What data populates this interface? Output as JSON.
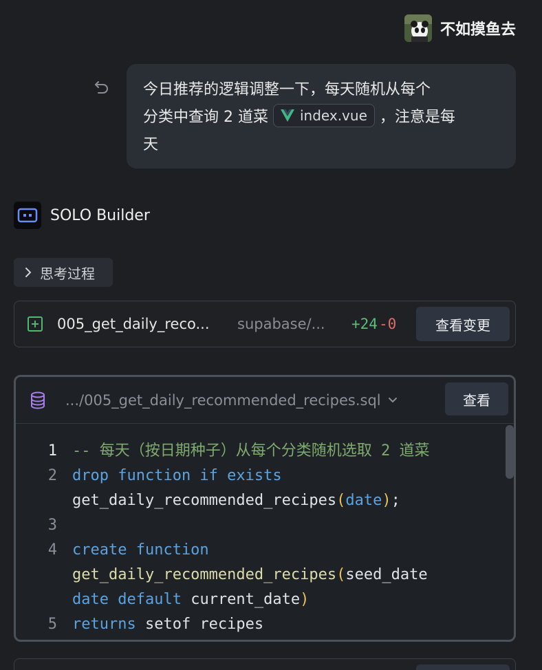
{
  "user": {
    "name": "不如摸鱼去",
    "avatar": "panda-avatar"
  },
  "message": {
    "text_before": "今日推荐的逻辑调整一下，每天随机从每个分类中查询 2 道菜",
    "file_chip": "index.vue",
    "text_after": "，注意是每天",
    "undo_icon": "undo-icon"
  },
  "builder": {
    "name": "SOLO Builder"
  },
  "thinking": {
    "label": "思考过程"
  },
  "change": {
    "file_name": "005_get_daily_reco...",
    "file_path": "supabase/...",
    "additions": "+24",
    "deletions": "-0",
    "button": "查看变更"
  },
  "code_card": {
    "path": ".../005_get_daily_recommended_recipes.sql",
    "button": "查看",
    "lines": [
      {
        "n": "1"
      },
      {
        "n": "2"
      },
      {
        "n": ""
      },
      {
        "n": "3"
      },
      {
        "n": "4"
      },
      {
        "n": ""
      },
      {
        "n": ""
      },
      {
        "n": "5"
      }
    ]
  },
  "colors": {
    "background": "#1e1f22",
    "comment": "#7faa6e",
    "keyword": "#5ba3e0",
    "function": "#dcdcaa",
    "additions": "#5bbf7a",
    "deletions": "#e06c6c"
  },
  "code": {
    "l1_comment": "-- 每天（按日期种子）从每个分类随机选取 2 道菜",
    "l2_kw": "drop function if exists",
    "l2b_fn": "get_daily_recommended_recipes",
    "l2b_open": "(",
    "l2b_arg": "date",
    "l2b_close": ")",
    "l2b_semi": ";",
    "l4_kw": "create function",
    "l4b_fn": "get_daily_recommended_recipes",
    "l4b_open": "(",
    "l4b_arg": "seed_date",
    "l4c_kw1": "date",
    "l4c_kw2": "default",
    "l4c_plain": "current_date",
    "l4c_close": ")",
    "l5_kw": "returns",
    "l5_plain": "setof recipes"
  }
}
